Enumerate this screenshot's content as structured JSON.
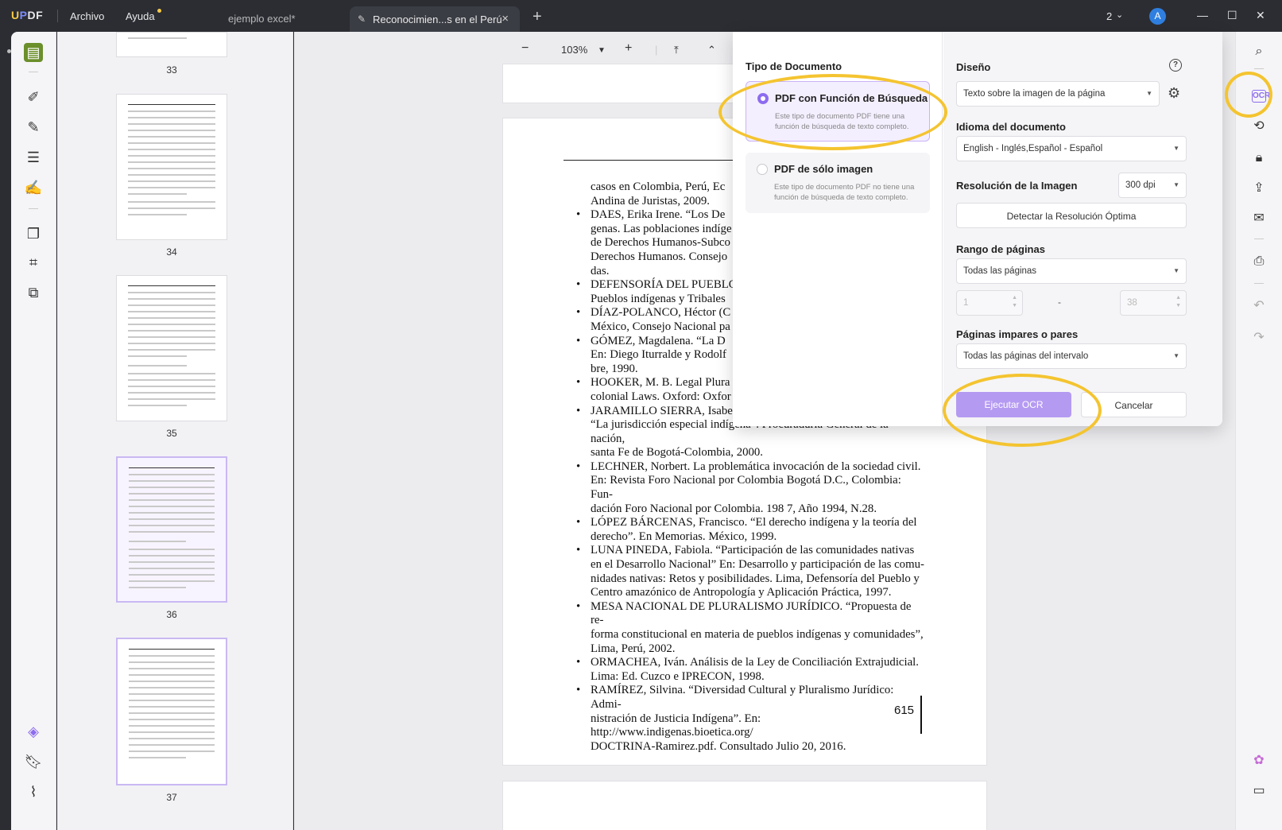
{
  "titlebar": {
    "logo": "UPDF",
    "menu": [
      "Archivo",
      "Ayuda"
    ],
    "tabs": [
      {
        "label": "ejemplo excel*"
      },
      {
        "label": "Reconocimien...s en el Perú"
      }
    ],
    "add_tab": "+",
    "window_count": "2",
    "avatar_initial": "A",
    "minimize": "—",
    "maximize": "☐",
    "close": "✕"
  },
  "thumbnails": {
    "pages": [
      "33",
      "34",
      "35",
      "36",
      "37"
    ],
    "selected": "36"
  },
  "toolbar": {
    "zoom_out": "−",
    "zoom_value": "103%",
    "zoom_in": "+",
    "first_page": "⤒",
    "prev_page": "⌃"
  },
  "document": {
    "page_number": "615",
    "entries": [
      {
        "bullet": false,
        "text": "casos en Colombia, Perú, Ec"
      },
      {
        "bullet": false,
        "text": "Andina de Juristas, 2009."
      },
      {
        "bullet": true,
        "text": "DAES, Erika Irene. “Los De"
      },
      {
        "bullet": false,
        "text": "genas. Las poblaciones indíge"
      },
      {
        "bullet": false,
        "text": "de Derechos Humanos-Subco"
      },
      {
        "bullet": false,
        "text": "Derechos Humanos. Consejo"
      },
      {
        "bullet": false,
        "text": "das."
      },
      {
        "bullet": true,
        "text": "DEFENSORÍA DEL PUEBLO"
      },
      {
        "bullet": false,
        "text": "Pueblos indígenas y Tribales"
      },
      {
        "bullet": true,
        "text": "DÍAZ-POLANCO, Héctor (C"
      },
      {
        "bullet": false,
        "text": "México, Consejo Nacional pa"
      },
      {
        "bullet": true,
        "text": "GÓMEZ, Magdalena. “La D"
      },
      {
        "bullet": false,
        "text": "En: Diego Iturralde y Rodolf"
      },
      {
        "bullet": false,
        "text": "bre, 1990."
      },
      {
        "bullet": true,
        "text": "HOOKER, M. B. Legal Plura"
      },
      {
        "bullet": false,
        "text": "colonial Laws. Oxford: Oxfor"
      },
      {
        "bullet": true,
        "text": "JARAMILLO SIERRA, Isabe"
      },
      {
        "bullet": false,
        "text": "“La jurisdicción especial indígena”. Procuraduría General de la nación,"
      },
      {
        "bullet": false,
        "text": "santa Fe de Bogotá-Colombia, 2000."
      },
      {
        "bullet": true,
        "text": "LECHNER, Norbert. La problemática invocación de la sociedad civil."
      },
      {
        "bullet": false,
        "text": "En: Revista Foro Nacional por Colombia Bogotá D.C., Colombia: Fun-"
      },
      {
        "bullet": false,
        "text": "dación Foro Nacional por Colombia. 198 7, Año 1994, N.28."
      },
      {
        "bullet": true,
        "text": "LÓPEZ BÁRCENAS, Francisco. “El derecho indígena y la teoría del"
      },
      {
        "bullet": false,
        "text": "derecho”. En Memorias. México, 1999."
      },
      {
        "bullet": true,
        "text": "LUNA PINEDA, Fabiola. “Participación de las comunidades nativas"
      },
      {
        "bullet": false,
        "text": "en el Desarrollo Nacional” En: Desarrollo y participación de las comu-"
      },
      {
        "bullet": false,
        "text": "nidades nativas: Retos y posibilidades. Lima, Defensoría del Pueblo y"
      },
      {
        "bullet": false,
        "text": "Centro amazónico de Antropología y Aplicación Práctica, 1997."
      },
      {
        "bullet": true,
        "text": "MESA NACIONAL DE PLURALISMO JURÍDICO. “Propuesta de re-"
      },
      {
        "bullet": false,
        "text": "forma constitucional en materia de pueblos indígenas y comunidades”,"
      },
      {
        "bullet": false,
        "text": "Lima, Perú, 2002."
      },
      {
        "bullet": true,
        "text": "ORMACHEA, Iván. Análisis de la Ley de Conciliación Extrajudicial."
      },
      {
        "bullet": false,
        "text": "Lima: Ed. Cuzco e IPRECON, 1998."
      },
      {
        "bullet": true,
        "text": "RAMÍREZ, Silvina. “Diversidad Cultural y Pluralismo Jurídico: Admi-"
      },
      {
        "bullet": false,
        "text": "nistración de Justicia Indígena”. En: http://www.indigenas.bioetica.org/"
      },
      {
        "bullet": false,
        "text": "DOCTRINA-Ramirez.pdf. Consultado Julio 20, 2016."
      }
    ]
  },
  "ocr": {
    "tipo_heading": "Tipo de Documento",
    "options": [
      {
        "title": "PDF con Función de Búsqueda",
        "desc": "Este tipo de documento PDF tiene una función de búsqueda de texto completo.",
        "selected": true
      },
      {
        "title": "PDF de sólo imagen",
        "desc": "Este tipo de documento PDF no tiene una función de búsqueda de texto completo.",
        "selected": false
      }
    ],
    "diseno_label": "Diseño",
    "diseno_value": "Texto sobre la imagen de la página",
    "help": "?",
    "idioma_label": "Idioma del documento",
    "idioma_value": "English - Inglés,Español - Español",
    "resolucion_label": "Resolución de la Imagen",
    "resolucion_value": "300 dpi",
    "detect_button": "Detectar la Resolución Óptima",
    "rango_label": "Rango de páginas",
    "rango_value": "Todas las páginas",
    "range_from": "1",
    "range_sep": "-",
    "range_to": "38",
    "impares_label": "Páginas impares o pares",
    "impares_value": "Todas las páginas del intervalo",
    "run_button": "Ejecutar OCR",
    "cancel_button": "Cancelar"
  },
  "colors": {
    "accent": "#8d6cf0",
    "primary_button": "#b59af2",
    "highlight": "#f4c430",
    "titlebar": "#2b2d33"
  }
}
